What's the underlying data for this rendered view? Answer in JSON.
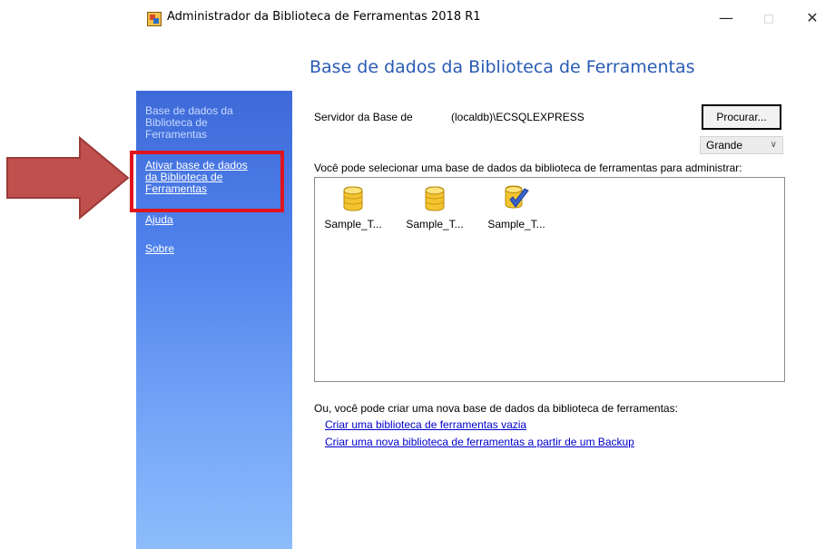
{
  "window": {
    "title": "Administrador da Biblioteca de Ferramentas 2018 R1",
    "minimize": "—",
    "maximize": "□",
    "close": "✕"
  },
  "header": {
    "title": "Base de dados da Biblioteca de Ferramentas"
  },
  "sidebar": {
    "items": [
      {
        "label": "Base de dados da Biblioteca de Ferramentas",
        "lines": [
          "Base de dados da",
          "Biblioteca de",
          "Ferramentas"
        ]
      },
      {
        "label": "Ativar base de dados da Biblioteca de Ferramentas",
        "lines": [
          "Ativar base de dados",
          "da Biblioteca de",
          "Ferramentas"
        ]
      },
      {
        "label": "Ajuda"
      },
      {
        "label": "Sobre"
      }
    ]
  },
  "main": {
    "server_label": "Servidor da Base de",
    "server_value": "(localdb)\\ECSQLEXPRESS",
    "browse_button": "Procurar...",
    "view_size": "Grande",
    "select_label": "Você pode selecionar uma base de dados da biblioteca de ferramentas para administrar:",
    "databases": [
      {
        "name": "Sample_T...",
        "icon": "database-icon"
      },
      {
        "name": "Sample_T...",
        "icon": "database-icon"
      },
      {
        "name": "Sample_T...",
        "icon": "database-active-icon"
      }
    ],
    "create_text": "Ou, você pode criar uma nova base de dados da biblioteca de ferramentas:",
    "links": {
      "empty": "Criar uma biblioteca de ferramentas vazia",
      "backup": "Criar uma nova biblioteca de ferramentas a partir de um Backup"
    }
  },
  "annotation": {
    "highlight_color": "#e0141e",
    "arrow_color": "#c0504d"
  }
}
